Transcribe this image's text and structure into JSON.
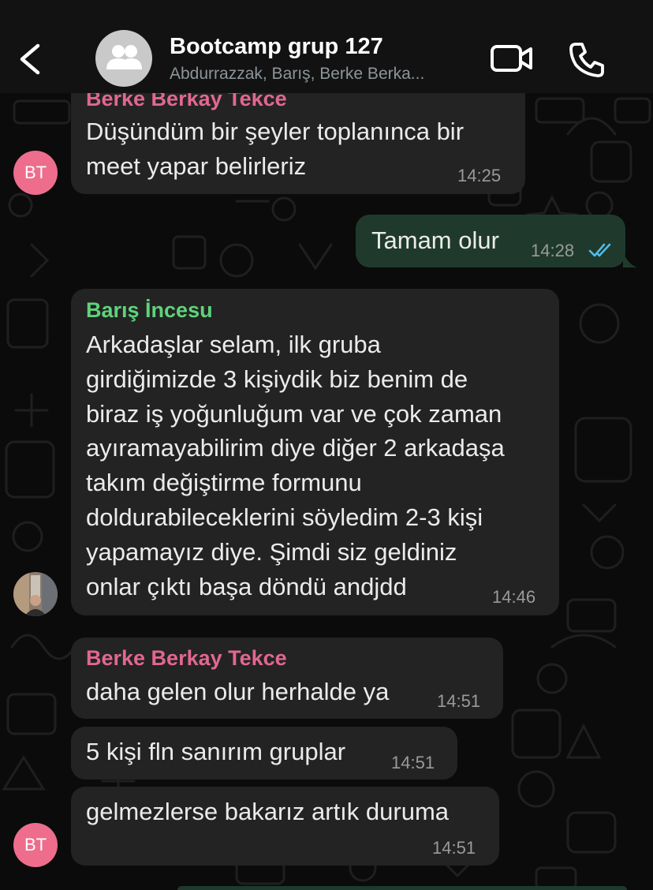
{
  "header": {
    "title": "Bootcamp grup 127",
    "subtitle": "Abdurrazzak, Barış, Berke Berka..."
  },
  "avatars": {
    "bt_initials": "BT"
  },
  "messages": [
    {
      "sender": "Berke Berkay Tekce",
      "text": "Düşündüm bir şeyler toplanınca bir\nmeet yapar belirleriz",
      "time": "14:25"
    },
    {
      "text": "Tamam olur",
      "time": "14:28",
      "status": "read"
    },
    {
      "sender": "Barış İncesu",
      "text": "Arkadaşlar selam, ilk gruba\ngirdiğimizde 3 kişiydik biz benim de\nbiraz iş yoğunluğum var ve çok zaman\nayıramayabilirim diye diğer 2 arkadaşa\ntakım değiştirme formunu\ndoldurabileceklerini söyledim 2-3 kişi\nyapamayız diye. Şimdi siz geldiniz\nonlar çıktı başa döndü andjdd",
      "time": "14:46"
    },
    {
      "sender": "Berke Berkay Tekce",
      "text": "daha gelen olur herhalde ya",
      "time": "14:51"
    },
    {
      "text": "5 kişi fln sanırım gruplar",
      "time": "14:51"
    },
    {
      "text": "gelmezlerse bakarız artık duruma",
      "time": "14:51"
    }
  ],
  "colors": {
    "incoming_bubble": "#232323",
    "outgoing_bubble": "#1f3a2d",
    "sender_pink": "#e0688f",
    "sender_green": "#5fd37b",
    "read_ticks": "#53bdeb",
    "avatar_bt": "#ee6d8d"
  },
  "icons": [
    "back-chevron-icon",
    "group-people-icon",
    "video-camera-icon",
    "phone-icon",
    "double-check-icon"
  ]
}
